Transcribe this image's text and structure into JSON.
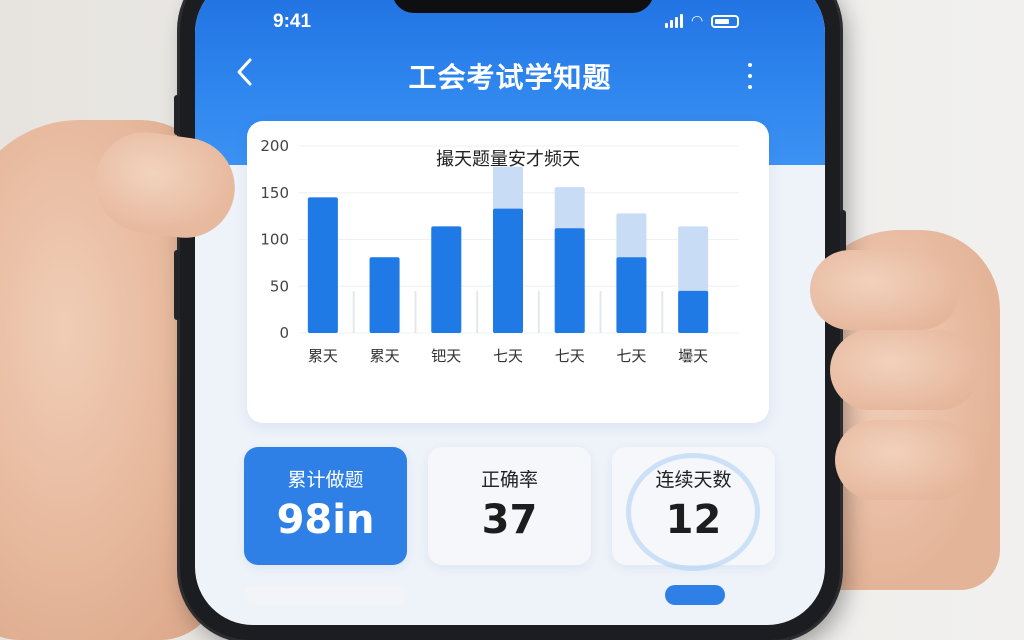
{
  "status_bar": {
    "time": "9:41"
  },
  "header": {
    "title": "工会考试学知题"
  },
  "chart_data": {
    "type": "bar",
    "title": "撮天题量安才频天",
    "categories": [
      "累天",
      "累天",
      "钯天",
      "七天",
      "七天",
      "七天",
      "壜天"
    ],
    "yticks": [
      0,
      50,
      100,
      150,
      200
    ],
    "ylim": [
      0,
      200
    ],
    "series": [
      {
        "values": [
          145,
          81,
          114,
          133,
          112,
          81,
          45
        ]
      },
      {
        "values": [
          145,
          81,
          114,
          178,
          156,
          128,
          114
        ]
      }
    ],
    "colors": {
      "primary": "#1f7ae6",
      "secondary": "#c9dcf5"
    }
  },
  "stats": [
    {
      "label": "累计做题",
      "value": "98in"
    },
    {
      "label": "正确率",
      "value": "37"
    },
    {
      "label": "连续天数",
      "value": "12"
    }
  ],
  "colors": {
    "brand": "#1f6fe0",
    "accent": "#2f80e6"
  }
}
